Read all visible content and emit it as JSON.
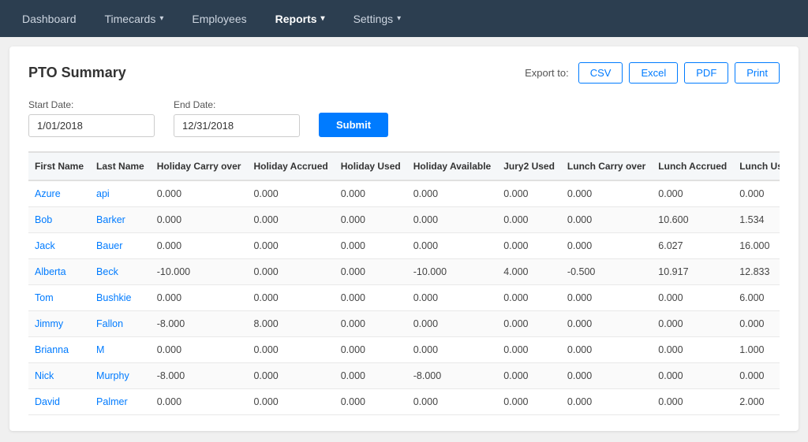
{
  "nav": {
    "items": [
      {
        "label": "Dashboard",
        "active": false,
        "hasChevron": false
      },
      {
        "label": "Timecards",
        "active": false,
        "hasChevron": true
      },
      {
        "label": "Employees",
        "active": false,
        "hasChevron": false
      },
      {
        "label": "Reports",
        "active": true,
        "hasChevron": true
      },
      {
        "label": "Settings",
        "active": false,
        "hasChevron": true
      }
    ]
  },
  "page": {
    "title": "PTO Summary",
    "export_label": "Export to:",
    "export_buttons": [
      "CSV",
      "Excel",
      "PDF",
      "Print"
    ],
    "start_date_label": "Start Date:",
    "start_date_value": "1/01/2018",
    "end_date_label": "End Date:",
    "end_date_value": "12/31/2018",
    "submit_label": "Submit"
  },
  "table": {
    "columns": [
      "First Name",
      "Last Name",
      "Holiday Carry over",
      "Holiday Accrued",
      "Holiday Used",
      "Holiday Available",
      "Jury2 Used",
      "Lunch Carry over",
      "Lunch Accrued",
      "Lunch Used"
    ],
    "rows": [
      {
        "first": "Azure",
        "last": "api",
        "hco": "0.000",
        "ha": "0.000",
        "hu": "0.000",
        "hav": "0.000",
        "j2u": "0.000",
        "lco": "0.000",
        "la": "0.000",
        "lu": "0.000"
      },
      {
        "first": "Bob",
        "last": "Barker",
        "hco": "0.000",
        "ha": "0.000",
        "hu": "0.000",
        "hav": "0.000",
        "j2u": "0.000",
        "lco": "0.000",
        "la": "10.600",
        "lu": "1.534"
      },
      {
        "first": "Jack",
        "last": "Bauer",
        "hco": "0.000",
        "ha": "0.000",
        "hu": "0.000",
        "hav": "0.000",
        "j2u": "0.000",
        "lco": "0.000",
        "la": "6.027",
        "lu": "16.000"
      },
      {
        "first": "Alberta",
        "last": "Beck",
        "hco": "-10.000",
        "ha": "0.000",
        "hu": "0.000",
        "hav": "-10.000",
        "j2u": "4.000",
        "lco": "-0.500",
        "la": "10.917",
        "lu": "12.833"
      },
      {
        "first": "Tom",
        "last": "Bushkie",
        "hco": "0.000",
        "ha": "0.000",
        "hu": "0.000",
        "hav": "0.000",
        "j2u": "0.000",
        "lco": "0.000",
        "la": "0.000",
        "lu": "6.000"
      },
      {
        "first": "Jimmy",
        "last": "Fallon",
        "hco": "-8.000",
        "ha": "8.000",
        "hu": "0.000",
        "hav": "0.000",
        "j2u": "0.000",
        "lco": "0.000",
        "la": "0.000",
        "lu": "0.000"
      },
      {
        "first": "Brianna",
        "last": "M",
        "hco": "0.000",
        "ha": "0.000",
        "hu": "0.000",
        "hav": "0.000",
        "j2u": "0.000",
        "lco": "0.000",
        "la": "0.000",
        "lu": "1.000"
      },
      {
        "first": "Nick",
        "last": "Murphy",
        "hco": "-8.000",
        "ha": "0.000",
        "hu": "0.000",
        "hav": "-8.000",
        "j2u": "0.000",
        "lco": "0.000",
        "la": "0.000",
        "lu": "0.000"
      },
      {
        "first": "David",
        "last": "Palmer",
        "hco": "0.000",
        "ha": "0.000",
        "hu": "0.000",
        "hav": "0.000",
        "j2u": "0.000",
        "lco": "0.000",
        "la": "0.000",
        "lu": "2.000"
      }
    ]
  }
}
